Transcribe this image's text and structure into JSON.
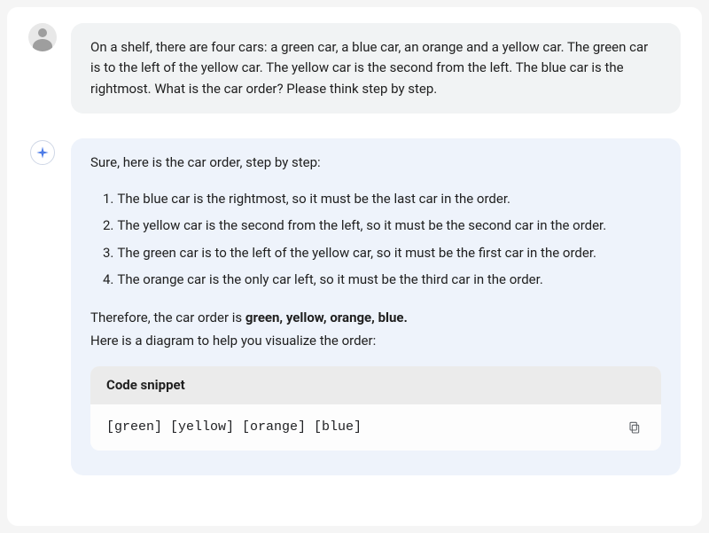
{
  "user": {
    "message": "On a shelf, there are four cars: a green car, a blue car, an orange and a yellow car. The green car is to the left of the yellow car. The yellow car is the second from the left. The blue car is the rightmost. What is the car order? Please think step by step."
  },
  "assistant": {
    "intro": "Sure, here is the car order, step by step:",
    "steps": [
      "The blue car is the rightmost, so it must be the last car in the order.",
      "The yellow car is the second from the left, so it must be the second car in the order.",
      "The green car is to the left of the yellow car, so it must be the first car in the order.",
      "The orange car is the only car left, so it must be the third car in the order."
    ],
    "therefore_prefix": "Therefore, the car order is ",
    "therefore_bold": "green, yellow, orange, blue.",
    "diagram_line": "Here is a diagram to help you visualize the order:",
    "code_label": "Code snippet",
    "code_content": "[green] [yellow] [orange] [blue]"
  }
}
